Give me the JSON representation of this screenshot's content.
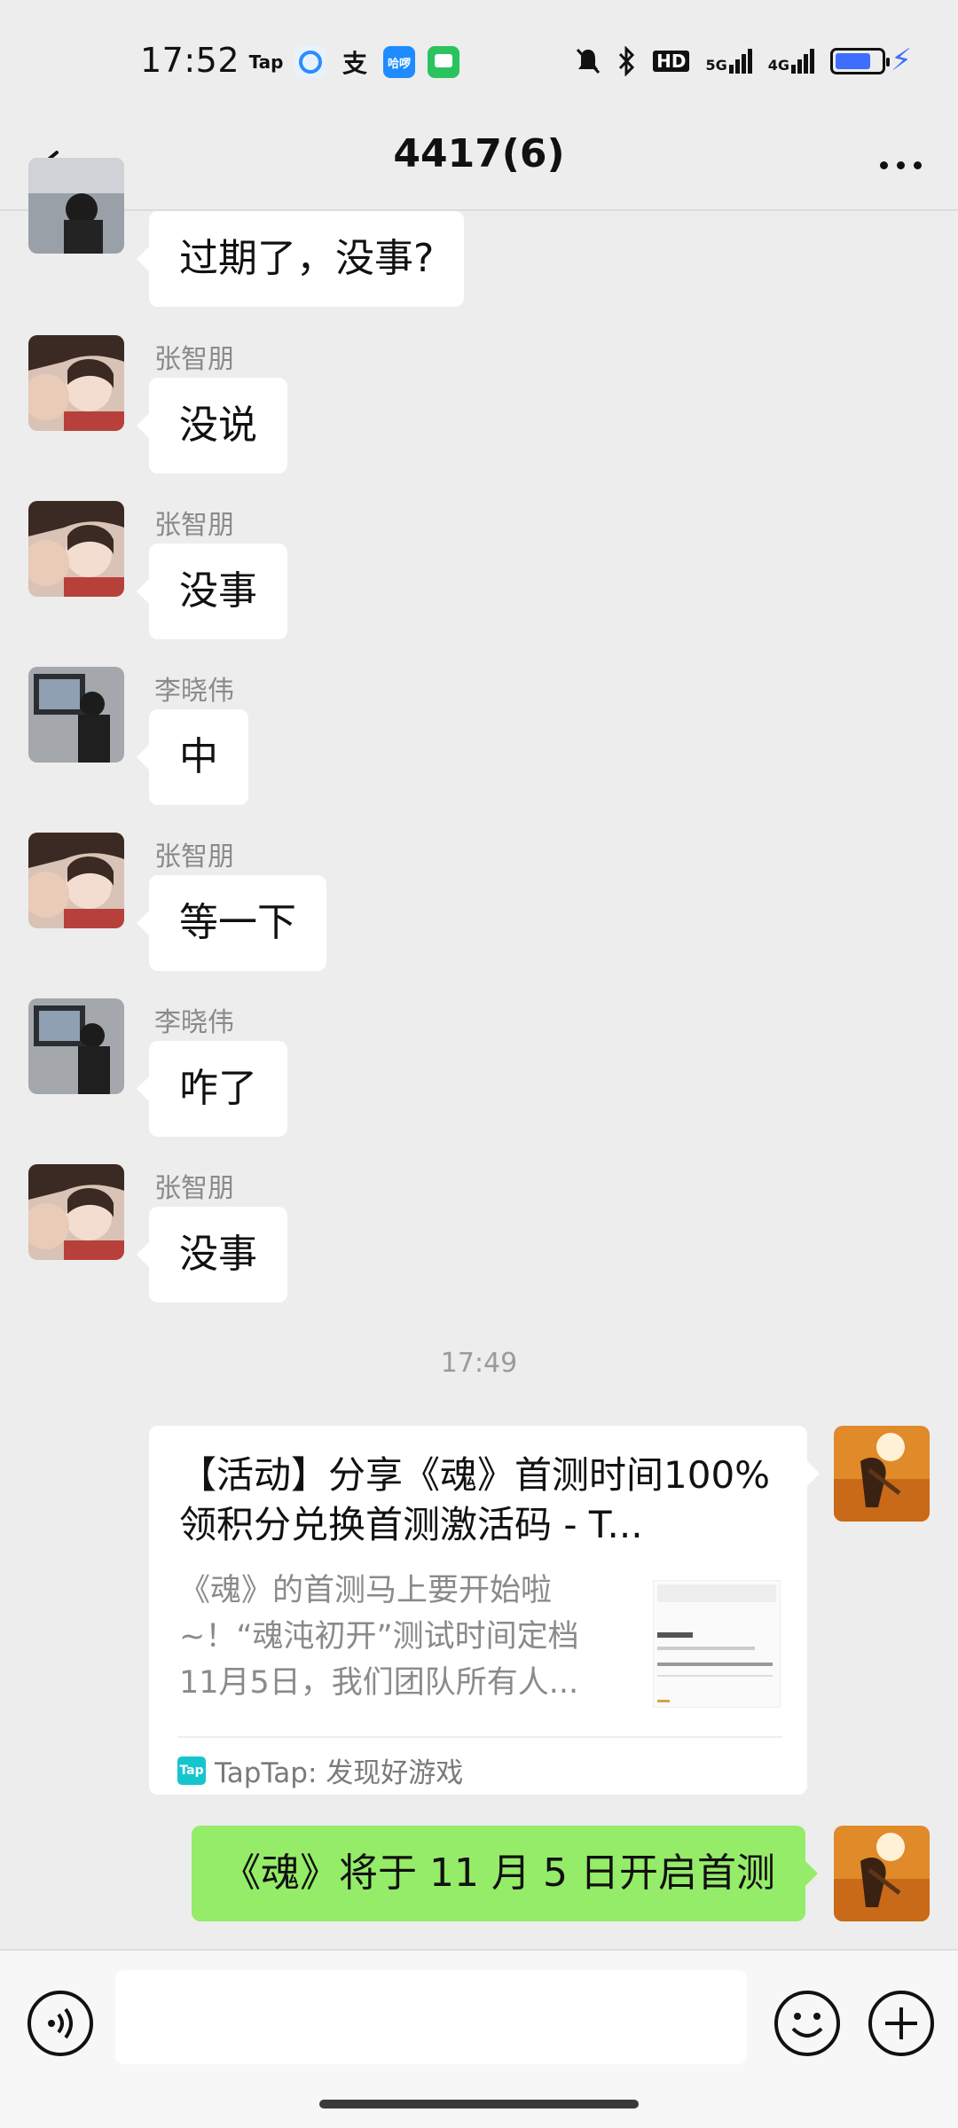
{
  "status": {
    "time": "17:52",
    "apps": [
      "Tap",
      "哈啰"
    ],
    "network": [
      "HD",
      "5G",
      "4G"
    ]
  },
  "header": {
    "title": "4417(6)"
  },
  "messages": [
    {
      "sender": "",
      "text": "过期了，没事?"
    },
    {
      "sender": "张智朋",
      "text": "没说"
    },
    {
      "sender": "张智朋",
      "text": "没事"
    },
    {
      "sender": "李晓伟",
      "text": "中"
    },
    {
      "sender": "张智朋",
      "text": "等一下"
    },
    {
      "sender": "李晓伟",
      "text": "咋了"
    },
    {
      "sender": "张智朋",
      "text": "没事"
    }
  ],
  "time_separator": "17:49",
  "shared_card": {
    "title": "【活动】分享《魂》首测时间100%领积分兑换首测激活码 - T...",
    "description": "《魂》的首测马上要开始啦~！“魂沌初开”测试时间定档11月5日，我们团队所有人...",
    "source": "TapTap: 发现好游戏",
    "badge": "Tap"
  },
  "my_message": "《魂》将于 11 月 5 日开启首测",
  "input": {
    "placeholder": ""
  }
}
